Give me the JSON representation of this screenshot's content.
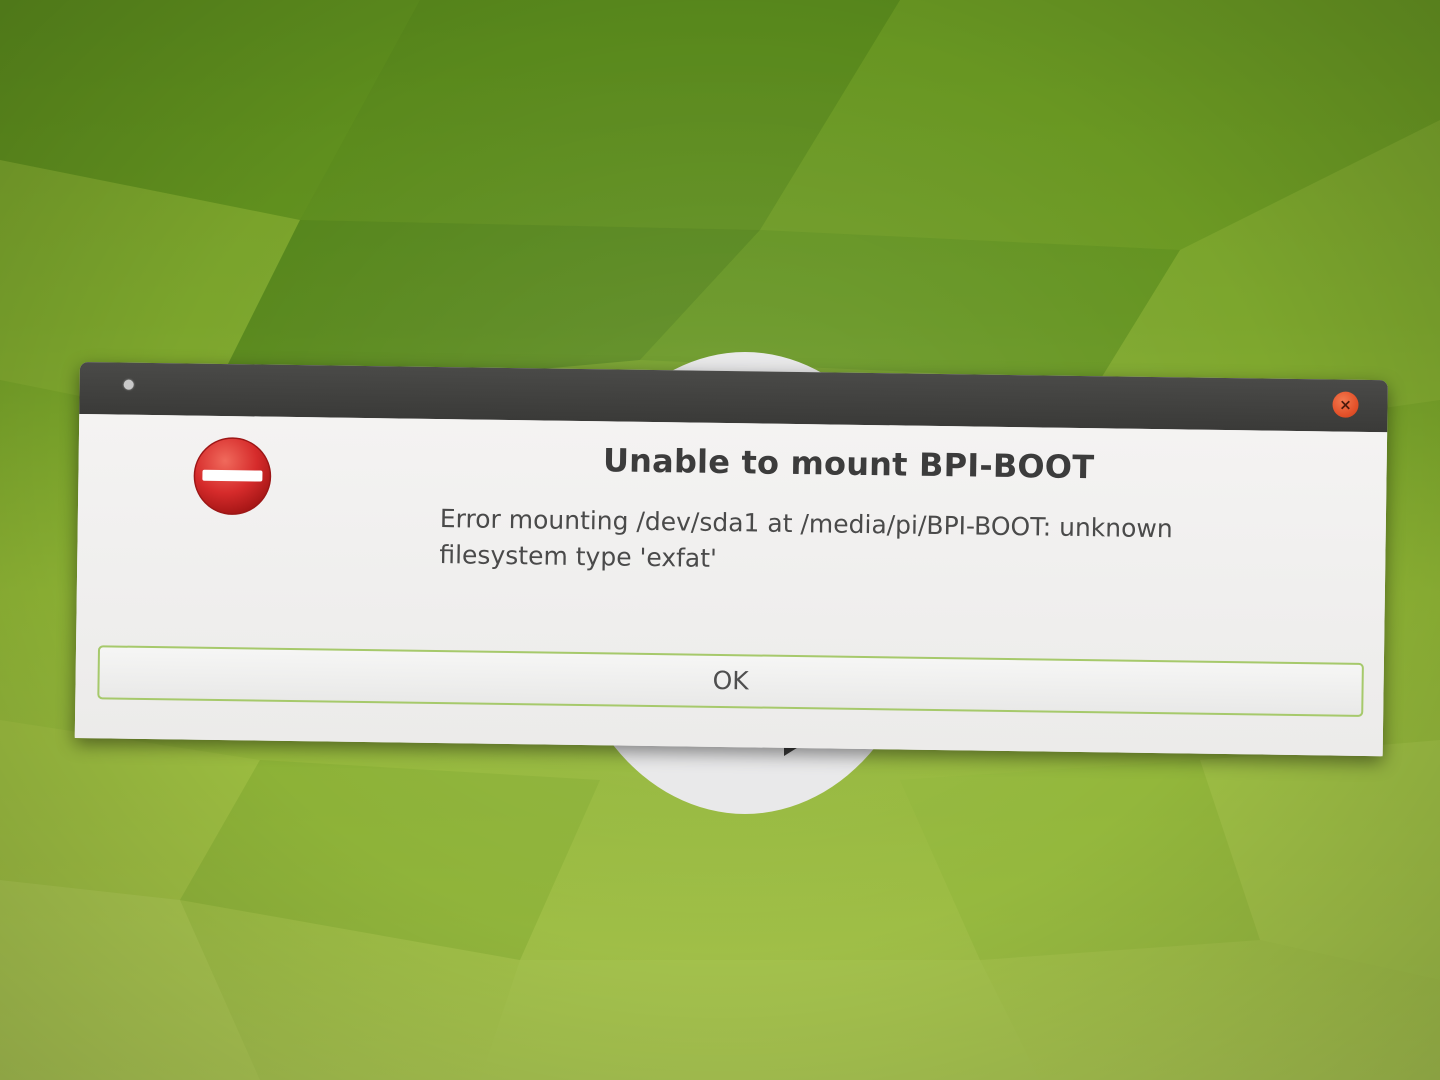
{
  "dialog": {
    "heading": "Unable to mount BPI-BOOT",
    "message": "Error mounting /dev/sda1 at /media/pi/BPI-BOOT: unknown filesystem type 'exfat'",
    "ok_label": "OK",
    "close_label": "×",
    "icon": "error-stop-icon"
  },
  "colors": {
    "background_green": "#7fa82d",
    "titlebar": "#3c3c3b",
    "close_button": "#e4552c",
    "error_icon": "#d62b2b",
    "ok_border": "#a6c96b"
  }
}
